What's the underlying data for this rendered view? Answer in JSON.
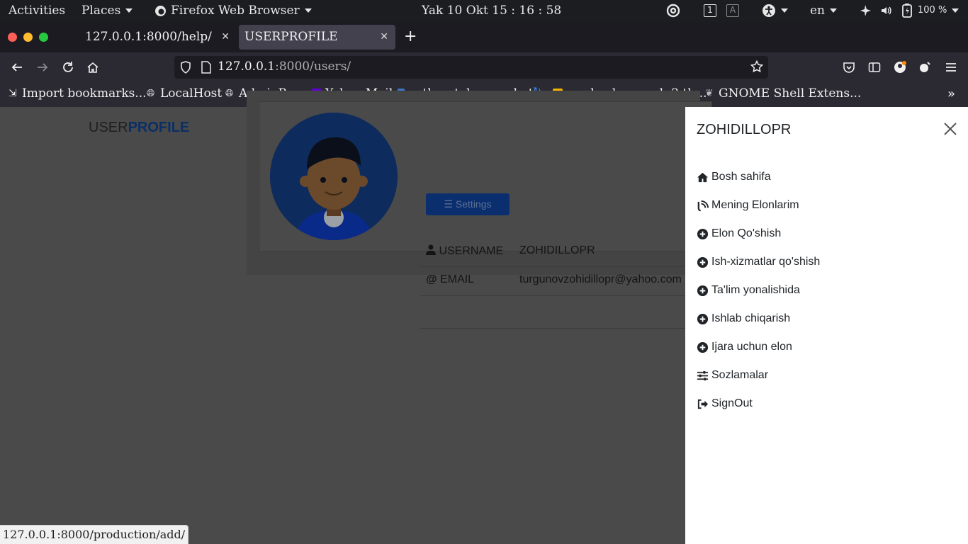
{
  "system_bar": {
    "activities": "Activities",
    "places": "Places",
    "app": "Firefox Web Browser",
    "clock": "Yak 10 Okt  15 : 16 : 58",
    "workspace_1": "1",
    "workspace_a": "A",
    "language": "en",
    "battery": "100 %"
  },
  "browser": {
    "tabs": [
      {
        "label": "127.0.0.1:8000/help/"
      },
      {
        "label": "USERPROFILE"
      }
    ],
    "url_host": "127.0.0.1",
    "url_path": ":8000/users/",
    "bookmarks": [
      {
        "label": "Import bookmarks..."
      },
      {
        "label": "LocalHost"
      },
      {
        "label": "AdminPage"
      },
      {
        "label": "Yahoo Mail"
      },
      {
        "label": "python-telegram-bot"
      },
      {
        "label": "sea background: 2 th..."
      },
      {
        "label": "GNOME Shell Extens..."
      }
    ]
  },
  "page": {
    "brand_left": "USER",
    "brand_right": "PROFILE",
    "profile": {
      "username_label": "USERNAME",
      "username_value": "ZOHIDILLOPR",
      "email_label": "EMAIL",
      "email_value": "turgunovzohidillopr@yahoo.com",
      "settings_button": "Settings"
    }
  },
  "panel": {
    "title": "ZOHIDILLOPR",
    "items": [
      {
        "label": "Bosh sahifa",
        "icon": "home-icon"
      },
      {
        "label": "Mening Elonlarim",
        "icon": "blog-icon"
      },
      {
        "label": "Elon Qo'shish",
        "icon": "plus-circle-icon"
      },
      {
        "label": "Ish-xizmatlar qo'shish",
        "icon": "plus-circle-icon"
      },
      {
        "label": "Ta'lim yonalishida",
        "icon": "plus-circle-icon"
      },
      {
        "label": "Ishlab chiqarish",
        "icon": "plus-circle-icon"
      },
      {
        "label": "Ijara uchun elon",
        "icon": "plus-circle-icon"
      },
      {
        "label": "Sozlamalar",
        "icon": "sliders-icon"
      },
      {
        "label": "SignOut",
        "icon": "sign-out-icon"
      }
    ]
  },
  "status_url": "127.0.0.1:8000/production/add/",
  "colors": {
    "brand_accent": "#0d3b8c",
    "overlay": "#4a4a4a",
    "panel_bg": "#ffffff"
  }
}
